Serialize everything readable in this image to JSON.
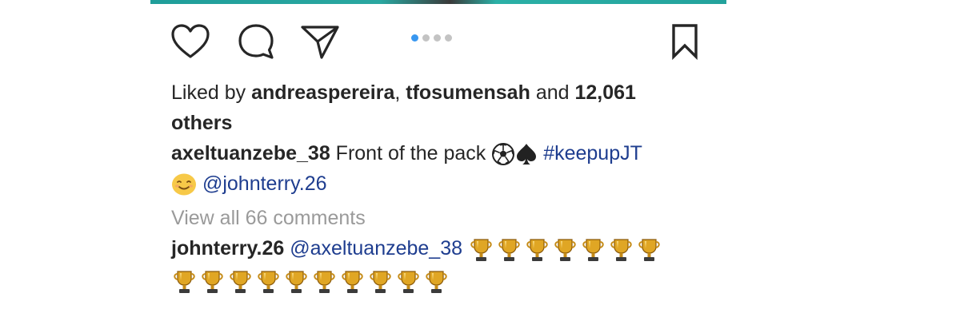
{
  "post": {
    "pagination": {
      "total": 4,
      "active": 1
    },
    "likes": {
      "prefix": "Liked by",
      "user1": "andreaspereira",
      "sep": ",",
      "user2": "tfosumensah",
      "and": "and",
      "count": "12,061",
      "others": "others"
    },
    "caption": {
      "username": "axeltuanzebe_38",
      "text": "Front of the pack",
      "hashtag": "#keepupJT",
      "mention": "@johnterry.26",
      "emojis": [
        "soccer-ball-icon",
        "spade-icon",
        "smiling-face-icon"
      ]
    },
    "view_all_comments": "View all 66 comments",
    "comment": {
      "username": "johnterry.26",
      "mention": "@axeltuanzebe_38",
      "trophy_count": 17
    }
  },
  "colors": {
    "text": "#262626",
    "link": "#1e3d8f",
    "muted": "#9a9a9a",
    "dot_active": "#3897f0",
    "dot_inactive": "#c3c3c3"
  }
}
